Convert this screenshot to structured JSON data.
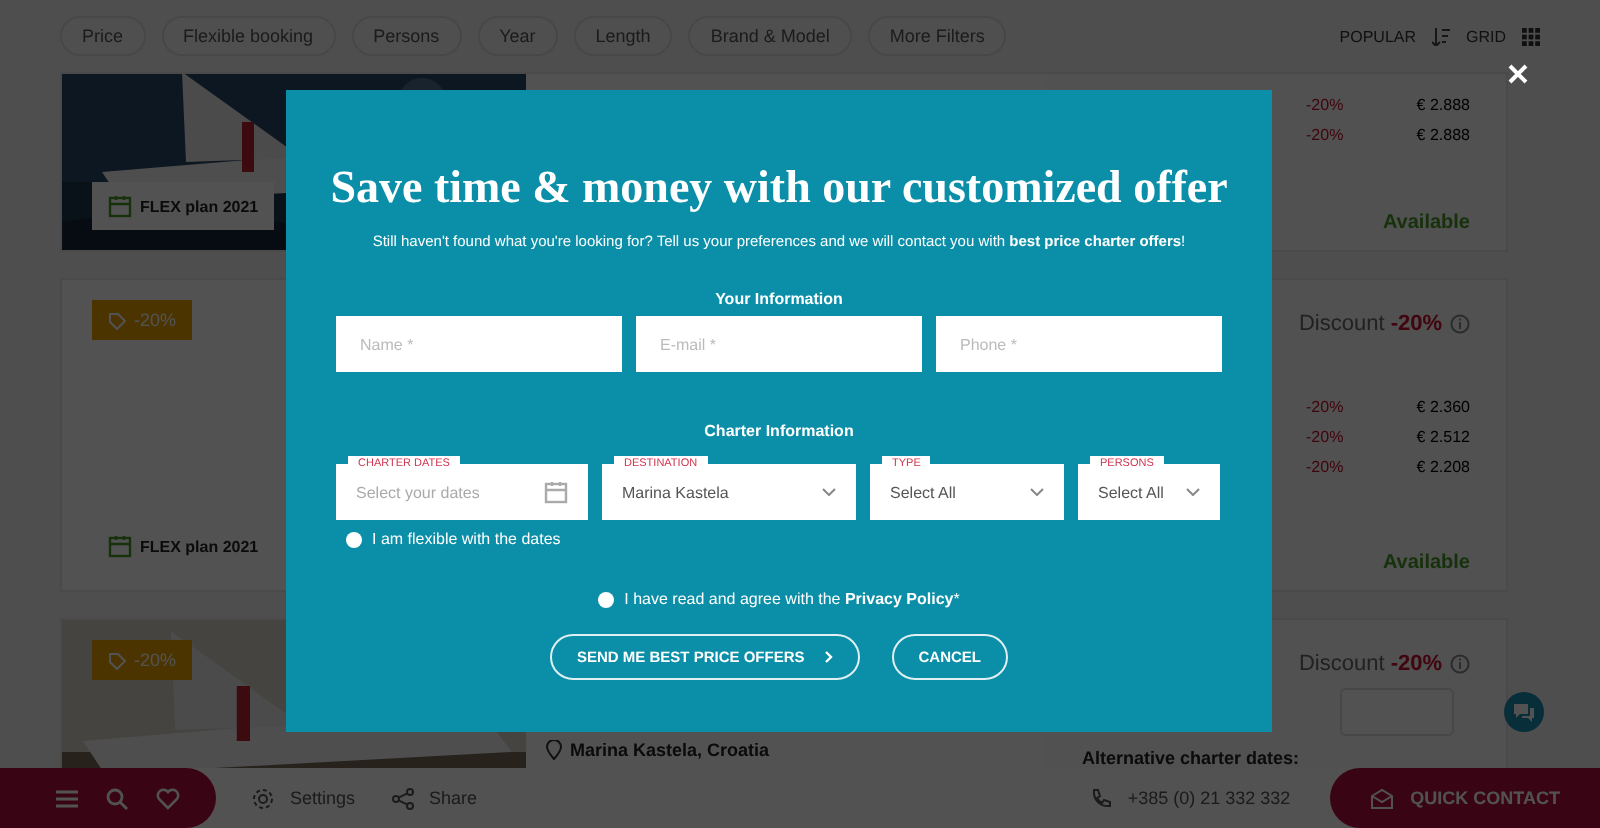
{
  "filters": [
    {
      "label": "Price"
    },
    {
      "label": "Flexible booking"
    },
    {
      "label": "Persons"
    },
    {
      "label": "Year"
    },
    {
      "label": "Length"
    },
    {
      "label": "Brand & Model"
    },
    {
      "label": "More Filters"
    }
  ],
  "sort": {
    "label": "POPULAR",
    "view": "GRID"
  },
  "cards": [
    {
      "plan": "FLEX plan 2021",
      "prices": [
        {
          "discount": "-20%",
          "price": "€ 2.888"
        },
        {
          "discount": "-20%",
          "price": "€ 2.888"
        }
      ],
      "status": "Available"
    },
    {
      "kind": "blank",
      "badge": "-20%",
      "plan": "FLEX plan 2021",
      "discount": {
        "label": "Discount",
        "value": "-20%"
      },
      "prices": [
        {
          "discount": "-20%",
          "price": "€ 2.360"
        },
        {
          "discount": "-20%",
          "price": "€ 2.512"
        },
        {
          "discount": "-20%",
          "price": "€ 2.208"
        }
      ],
      "status": "Available"
    },
    {
      "badge": "-20%",
      "location": "Marina Kastela, Croatia",
      "discount": {
        "label": "Discount",
        "value": "-20%"
      },
      "note": "Alternative charter dates:"
    }
  ],
  "modal": {
    "title": "Save time & money with our customized offer",
    "subtitle": "Still haven't found what you're looking for? Tell us your preferences and we will contact you with **best price charter offers**!",
    "your_info": {
      "heading": "Your Information",
      "fields": [
        {
          "placeholder": "Name *"
        },
        {
          "placeholder": "E-mail *"
        },
        {
          "placeholder": "Phone *"
        }
      ]
    },
    "charter_info": {
      "heading": "Charter Information",
      "fields": [
        {
          "kind": "date",
          "label": "CHARTER DATES",
          "placeholder": "Select your dates"
        },
        {
          "kind": "select",
          "label": "DESTINATION",
          "value": "Marina Kastela"
        },
        {
          "kind": "select",
          "label": "TYPE",
          "value": "Select All"
        },
        {
          "kind": "select",
          "label": "PERSONS",
          "value": "Select All"
        }
      ]
    },
    "flexible": {
      "label": "I am flexible with the dates",
      "checked": false
    },
    "privacy": {
      "label": "I have read and agree with the **Privacy Policy***",
      "checked": false
    },
    "buttons": [
      {
        "label": "SEND ME BEST PRICE OFFERS",
        "kind": "primary"
      },
      {
        "label": "CANCEL",
        "kind": "secondary"
      }
    ]
  },
  "bottom_bar": {
    "settings": "Settings",
    "share": "Share",
    "phone": "+385 (0) 21 332 332",
    "contact": "QUICK CONTACT"
  }
}
